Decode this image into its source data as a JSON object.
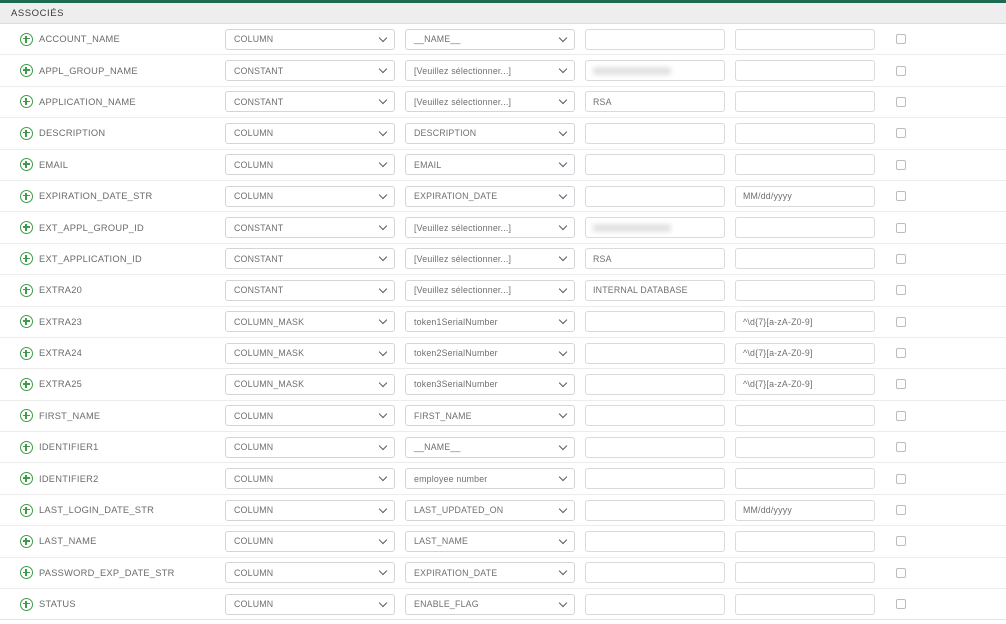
{
  "panel": {
    "title": "ASSOCIÉS",
    "accent_color": "#1b6b52",
    "header_bg": "#eeeeee",
    "icon_color": "#3f9c46"
  },
  "placeholders": {
    "select_prompt": "[Veuillez sélectionner...]"
  },
  "rows": [
    {
      "attr": "ACCOUNT_NAME",
      "icon": "plus-circle-icon",
      "type": "COLUMN",
      "mapping": "__NAME__",
      "value": "",
      "format": "",
      "redacted": false,
      "checked": false
    },
    {
      "attr": "APPL_GROUP_NAME",
      "icon": "plus-circle-icon",
      "type": "CONSTANT",
      "mapping": "[Veuillez sélectionner...]",
      "value": "",
      "format": "",
      "redacted": true,
      "checked": false
    },
    {
      "attr": "APPLICATION_NAME",
      "icon": "plus-circle-icon",
      "type": "CONSTANT",
      "mapping": "[Veuillez sélectionner...]",
      "value": "RSA",
      "format": "",
      "redacted": false,
      "checked": false
    },
    {
      "attr": "DESCRIPTION",
      "icon": "plus-circle-icon",
      "type": "COLUMN",
      "mapping": "DESCRIPTION",
      "value": "",
      "format": "",
      "redacted": false,
      "checked": false
    },
    {
      "attr": "EMAIL",
      "icon": "plus-circle-icon",
      "type": "COLUMN",
      "mapping": "EMAIL",
      "value": "",
      "format": "",
      "redacted": false,
      "checked": false
    },
    {
      "attr": "EXPIRATION_DATE_STR",
      "icon": "plus-circle-icon",
      "type": "COLUMN",
      "mapping": "EXPIRATION_DATE",
      "value": "",
      "format": "MM/dd/yyyy",
      "redacted": false,
      "checked": false
    },
    {
      "attr": "EXT_APPL_GROUP_ID",
      "icon": "plus-circle-icon",
      "type": "CONSTANT",
      "mapping": "[Veuillez sélectionner...]",
      "value": "",
      "format": "",
      "redacted": true,
      "checked": false
    },
    {
      "attr": "EXT_APPLICATION_ID",
      "icon": "plus-circle-icon",
      "type": "CONSTANT",
      "mapping": "[Veuillez sélectionner...]",
      "value": "RSA",
      "format": "",
      "redacted": false,
      "checked": false
    },
    {
      "attr": "EXTRA20",
      "icon": "plus-circle-icon",
      "type": "CONSTANT",
      "mapping": "[Veuillez sélectionner...]",
      "value": "INTERNAL DATABASE",
      "format": "",
      "redacted": false,
      "checked": false
    },
    {
      "attr": "EXTRA23",
      "icon": "plus-circle-icon",
      "type": "COLUMN_MASK",
      "mapping": "token1SerialNumber",
      "value": "",
      "format": "^\\d{7}[a-zA-Z0-9]",
      "redacted": false,
      "checked": false
    },
    {
      "attr": "EXTRA24",
      "icon": "plus-circle-icon",
      "type": "COLUMN_MASK",
      "mapping": "token2SerialNumber",
      "value": "",
      "format": "^\\d{7}[a-zA-Z0-9]",
      "redacted": false,
      "checked": false
    },
    {
      "attr": "EXTRA25",
      "icon": "plus-circle-icon",
      "type": "COLUMN_MASK",
      "mapping": "token3SerialNumber",
      "value": "",
      "format": "^\\d{7}[a-zA-Z0-9]",
      "redacted": false,
      "checked": false
    },
    {
      "attr": "FIRST_NAME",
      "icon": "plus-circle-icon",
      "type": "COLUMN",
      "mapping": "FIRST_NAME",
      "value": "",
      "format": "",
      "redacted": false,
      "checked": false
    },
    {
      "attr": "IDENTIFIER1",
      "icon": "plus-circle-icon",
      "type": "COLUMN",
      "mapping": "__NAME__",
      "value": "",
      "format": "",
      "redacted": false,
      "checked": false
    },
    {
      "attr": "IDENTIFIER2",
      "icon": "plus-circle-icon",
      "type": "COLUMN",
      "mapping": "employee number",
      "value": "",
      "format": "",
      "redacted": false,
      "checked": false
    },
    {
      "attr": "LAST_LOGIN_DATE_STR",
      "icon": "plus-circle-icon",
      "type": "COLUMN",
      "mapping": "LAST_UPDATED_ON",
      "value": "",
      "format": "MM/dd/yyyy",
      "redacted": false,
      "checked": false
    },
    {
      "attr": "LAST_NAME",
      "icon": "plus-circle-icon",
      "type": "COLUMN",
      "mapping": "LAST_NAME",
      "value": "",
      "format": "",
      "redacted": false,
      "checked": false
    },
    {
      "attr": "PASSWORD_EXP_DATE_STR",
      "icon": "plus-circle-icon",
      "type": "COLUMN",
      "mapping": "EXPIRATION_DATE",
      "value": "",
      "format": "",
      "redacted": false,
      "checked": false
    },
    {
      "attr": "STATUS",
      "icon": "plus-circle-icon",
      "type": "COLUMN",
      "mapping": "ENABLE_FLAG",
      "value": "",
      "format": "",
      "redacted": false,
      "checked": false
    }
  ]
}
